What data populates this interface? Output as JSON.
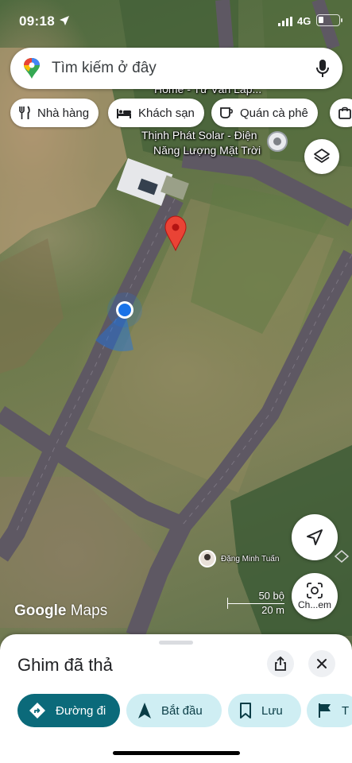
{
  "status_bar": {
    "time": "09:18",
    "network": "4G"
  },
  "search": {
    "placeholder": "Tìm kiếm ở đây"
  },
  "chips": [
    {
      "label": "Nhà hàng",
      "icon": "fork-knife-icon"
    },
    {
      "label": "Khách sạn",
      "icon": "bed-icon"
    },
    {
      "label": "Quán cà phê",
      "icon": "coffee-cup-icon"
    }
  ],
  "map": {
    "label_top": "Home - Tư Vấn Lắp...",
    "poi_line1": "Thịnh Phát Solar - Điện",
    "poi_line2": "Năng Lượng Mặt Trời",
    "user_name": "Đặng Minh Tuấn",
    "google_logo": "Google",
    "maps_word": "Maps",
    "scale_imperial": "50 bộ",
    "scale_metric": "20 m",
    "lens_label": "Ch...em"
  },
  "sheet": {
    "title": "Ghim đã thả",
    "actions": [
      {
        "label": "Đường đi",
        "style": "primary",
        "icon": "directions-icon"
      },
      {
        "label": "Bắt đầu",
        "style": "secondary",
        "icon": "navigation-arrow-icon"
      },
      {
        "label": "Lưu",
        "style": "secondary",
        "icon": "bookmark-icon"
      },
      {
        "label": "T",
        "style": "secondary",
        "icon": "flag-icon"
      }
    ]
  },
  "colors": {
    "accent": "#0b6a7a",
    "chip_secondary": "#cfeef3",
    "pin_red": "#ea4335",
    "location_blue": "#1a73e8"
  }
}
